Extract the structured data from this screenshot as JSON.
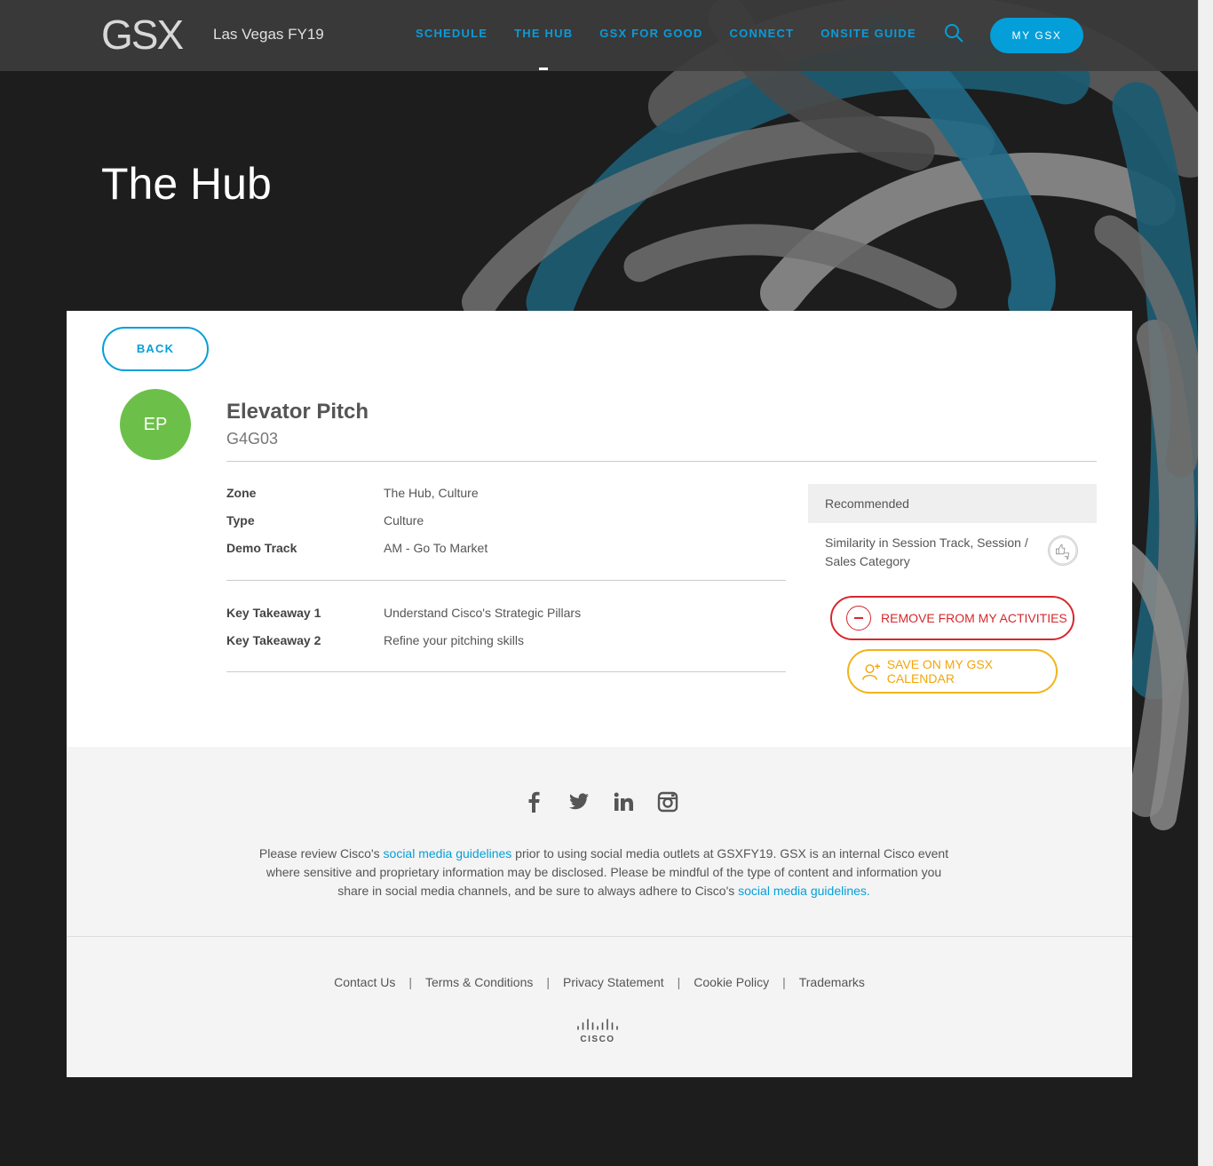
{
  "header": {
    "logo": "GSX",
    "event": "Las Vegas FY19",
    "nav": [
      {
        "label": "SCHEDULE"
      },
      {
        "label": "THE HUB"
      },
      {
        "label": "GSX FOR GOOD"
      },
      {
        "label": "CONNECT"
      },
      {
        "label": "ONSITE GUIDE"
      }
    ],
    "my_gsx": "MY GSX"
  },
  "hero": {
    "title": "The Hub"
  },
  "session": {
    "back": "BACK",
    "avatar": "EP",
    "title": "Elevator Pitch",
    "code": "G4G03",
    "details": [
      {
        "key": "Zone",
        "value": "The Hub, Culture"
      },
      {
        "key": "Type",
        "value": "Culture"
      },
      {
        "key": "Demo Track",
        "value": "AM - Go To Market"
      }
    ],
    "takeaways": [
      {
        "key": "Key Takeaway 1",
        "value": "Understand Cisco's Strategic Pillars"
      },
      {
        "key": "Key Takeaway 2",
        "value": "Refine your pitching skills"
      }
    ],
    "recommended": {
      "heading": "Recommended",
      "reason": "Similarity in Session Track, Session / Sales Category"
    },
    "remove_button": "REMOVE FROM MY ACTIVITIES",
    "save_button": "SAVE ON MY GSX CALENDAR"
  },
  "footer": {
    "disclaimer_1": "Please review Cisco's ",
    "link": "social media guidelines",
    "disclaimer_2": " prior to using social media outlets at GSXFY19. GSX is an internal Cisco event where sensitive and proprietary information may be disclosed. Please be mindful of the type of content and information you share in social media channels, and be sure to always adhere to Cisco's ",
    "link_2": "social media guidelines.",
    "links": [
      "Contact Us",
      "Terms & Conditions",
      "Privacy Statement",
      "Cookie Policy",
      "Trademarks"
    ],
    "cisco": "CISCO"
  },
  "colors": {
    "accent": "#049fd9",
    "avatar_green": "#6cc04a",
    "remove_red": "#d6282e",
    "save_yellow": "#f2b31a"
  }
}
